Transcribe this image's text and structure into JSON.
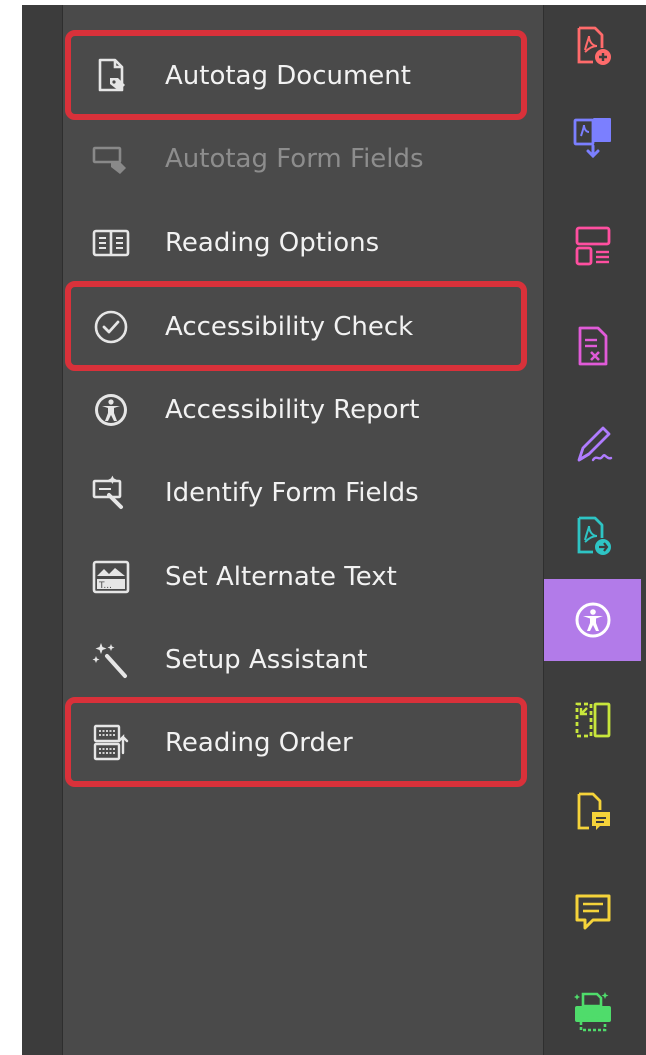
{
  "menu": {
    "items": [
      {
        "label": "Autotag Document",
        "icon": "autotag-document-icon",
        "highlighted": true,
        "disabled": false
      },
      {
        "label": "Autotag Form Fields",
        "icon": "autotag-form-fields-icon",
        "highlighted": false,
        "disabled": true
      },
      {
        "label": "Reading Options",
        "icon": "reading-options-icon",
        "highlighted": false,
        "disabled": false
      },
      {
        "label": "Accessibility Check",
        "icon": "accessibility-check-icon",
        "highlighted": true,
        "disabled": false
      },
      {
        "label": "Accessibility Report",
        "icon": "accessibility-report-icon",
        "highlighted": false,
        "disabled": false
      },
      {
        "label": "Identify Form Fields",
        "icon": "identify-form-fields-icon",
        "highlighted": false,
        "disabled": false
      },
      {
        "label": "Set Alternate Text",
        "icon": "set-alternate-text-icon",
        "highlighted": false,
        "disabled": false
      },
      {
        "label": "Setup Assistant",
        "icon": "setup-assistant-icon",
        "highlighted": false,
        "disabled": false
      },
      {
        "label": "Reading Order",
        "icon": "reading-order-icon",
        "highlighted": true,
        "disabled": false
      }
    ]
  },
  "toolbar": {
    "active_tool": "accessibility-tool",
    "tools": [
      {
        "icon": "create-pdf-icon",
        "color": "#ff6b6b"
      },
      {
        "icon": "combine-files-icon",
        "color": "#7b7fff"
      },
      {
        "icon": "organize-pages-icon",
        "color": "#ff4fa0"
      },
      {
        "icon": "edit-pdf-icon",
        "color": "#e05bd8"
      },
      {
        "icon": "fill-sign-icon",
        "color": "#b07cff"
      },
      {
        "icon": "export-pdf-icon",
        "color": "#2ec4c4"
      },
      {
        "icon": "accessibility-tool-icon",
        "color": "#ffffff"
      },
      {
        "icon": "compress-pdf-icon",
        "color": "#c8e63c"
      },
      {
        "icon": "comment-document-icon",
        "color": "#f5d33a"
      },
      {
        "icon": "comment-icon",
        "color": "#f5d33a"
      },
      {
        "icon": "print-production-icon",
        "color": "#4fdc6b"
      }
    ]
  },
  "colors": {
    "highlight": "#d9313a",
    "panel_bg": "#4a4a4a",
    "active_tool_bg": "#b27be9"
  }
}
